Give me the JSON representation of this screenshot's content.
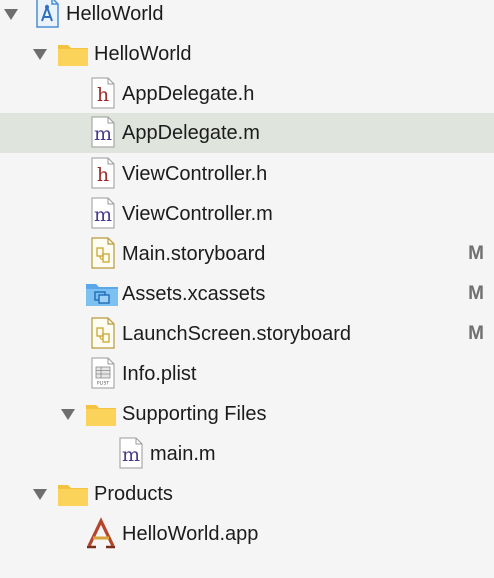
{
  "tree": {
    "project": {
      "label": "HelloWorld"
    },
    "group_helloworld": {
      "label": "HelloWorld"
    },
    "files": [
      {
        "label": "AppDelegate.h",
        "type": "h",
        "status": ""
      },
      {
        "label": "AppDelegate.m",
        "type": "m",
        "status": ""
      },
      {
        "label": "ViewController.h",
        "type": "h",
        "status": ""
      },
      {
        "label": "ViewController.m",
        "type": "m",
        "status": ""
      },
      {
        "label": "Main.storyboard",
        "type": "storyboard",
        "status": "M"
      },
      {
        "label": "Assets.xcassets",
        "type": "xcassets",
        "status": "M"
      },
      {
        "label": "LaunchScreen.storyboard",
        "type": "storyboard",
        "status": "M"
      },
      {
        "label": "Info.plist",
        "type": "plist",
        "status": ""
      }
    ],
    "supporting_files": {
      "label": "Supporting Files"
    },
    "supporting_children": [
      {
        "label": "main.m",
        "type": "m",
        "status": ""
      }
    ],
    "products": {
      "label": "Products"
    },
    "product_children": [
      {
        "label": "HelloWorld.app",
        "type": "app",
        "status": ""
      }
    ],
    "selected": "AppDelegate.m"
  },
  "colors": {
    "selected_row": "#dfe5dc",
    "folder": "#f7c948",
    "header_h": "#9b2a2a",
    "source_m": "#4a3a8a",
    "status": "#707070"
  },
  "icons": {
    "h_file": "header-file-icon",
    "m_file": "source-file-icon",
    "storyboard": "storyboard-file-icon",
    "xcassets": "asset-catalog-icon",
    "plist": "plist-file-icon",
    "app": "app-product-icon",
    "folder": "folder-icon",
    "project": "xcode-project-icon"
  }
}
